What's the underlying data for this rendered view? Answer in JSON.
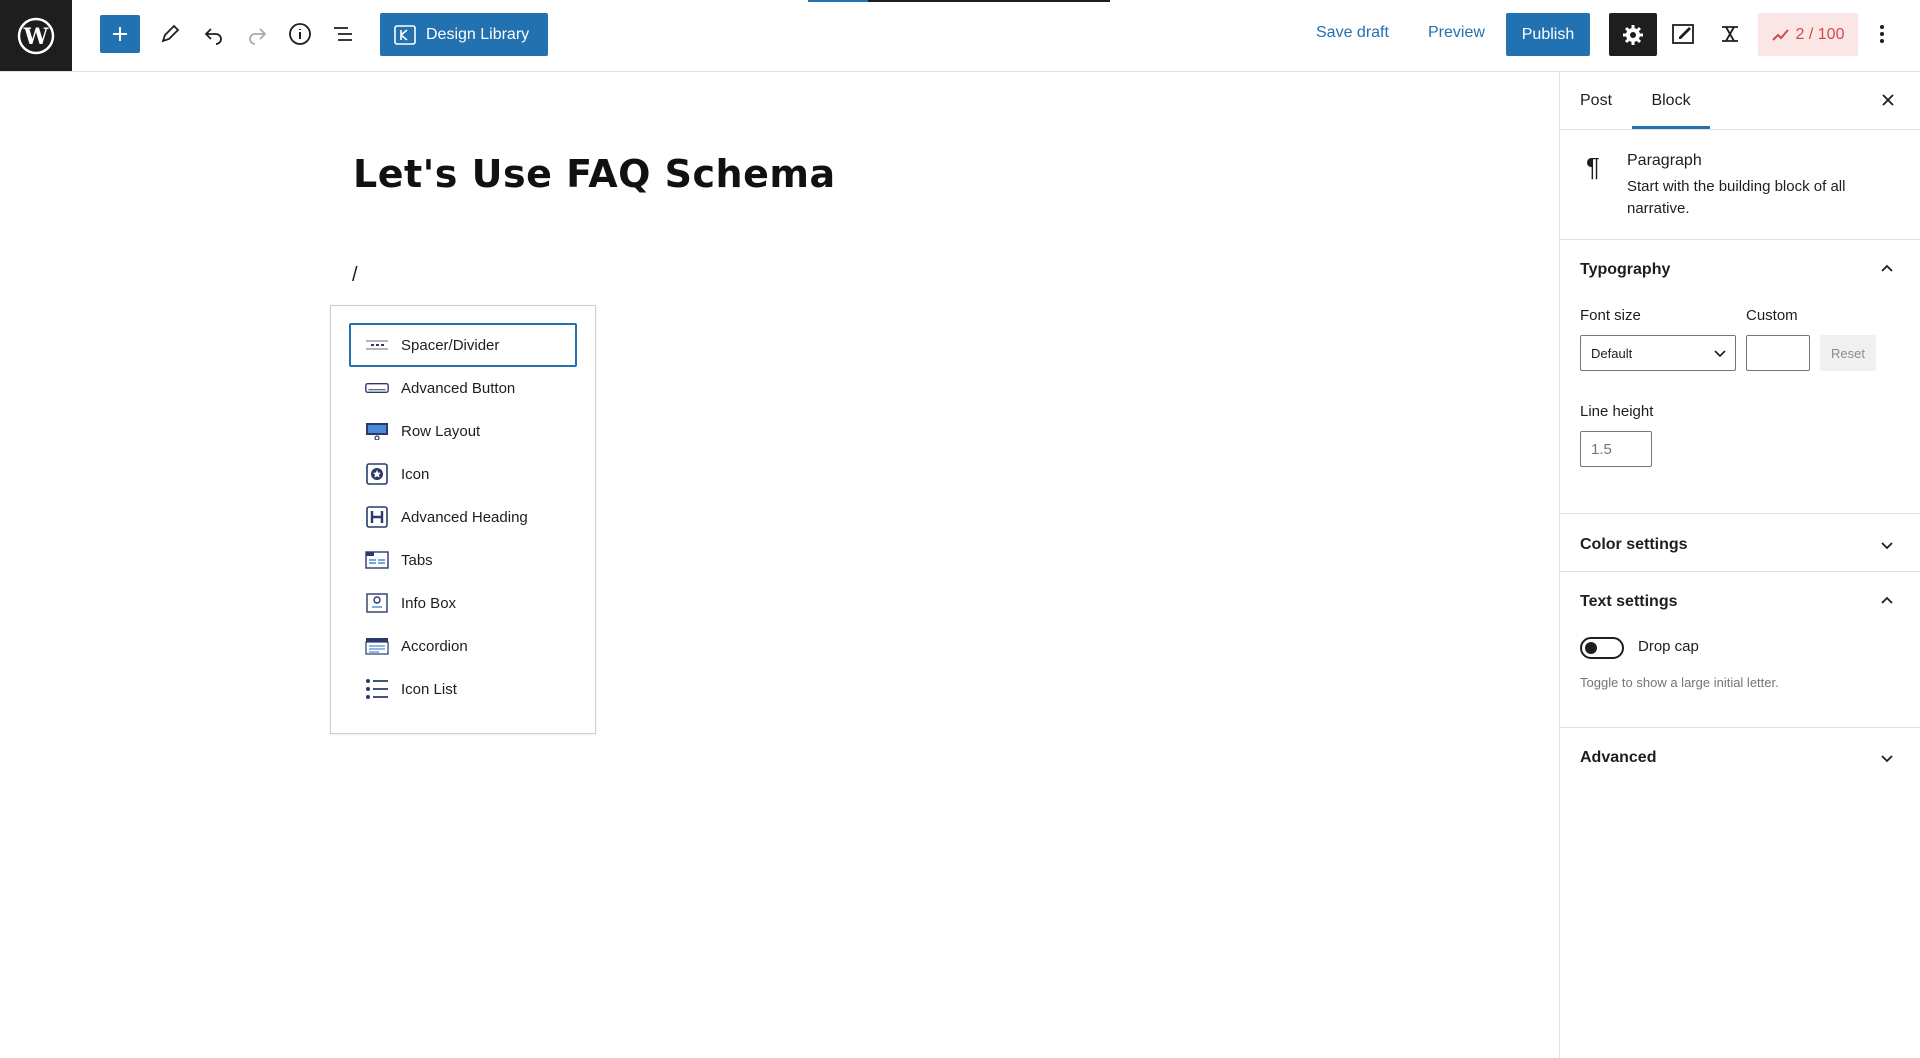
{
  "toolbar": {
    "design_library_label": "Design Library",
    "save_draft_label": "Save draft",
    "preview_label": "Preview",
    "publish_label": "Publish",
    "counter_label": "2 / 100"
  },
  "editor": {
    "post_title": "Let's Use FAQ Schema",
    "paragraph_text": "/"
  },
  "inserter": {
    "items": [
      {
        "label": "Spacer/Divider",
        "icon": "spacer-divider-icon"
      },
      {
        "label": "Advanced Button",
        "icon": "advanced-button-icon"
      },
      {
        "label": "Row Layout",
        "icon": "row-layout-icon"
      },
      {
        "label": "Icon",
        "icon": "icon-block-icon"
      },
      {
        "label": "Advanced Heading",
        "icon": "advanced-heading-icon"
      },
      {
        "label": "Tabs",
        "icon": "tabs-icon"
      },
      {
        "label": "Info Box",
        "icon": "info-box-icon"
      },
      {
        "label": "Accordion",
        "icon": "accordion-icon"
      },
      {
        "label": "Icon List",
        "icon": "icon-list-icon"
      }
    ]
  },
  "sidebar": {
    "tab_post": "Post",
    "tab_block": "Block",
    "block_card": {
      "title": "Paragraph",
      "description": "Start with the building block of all narrative."
    },
    "typography": {
      "title": "Typography",
      "font_size_label": "Font size",
      "custom_label": "Custom",
      "font_size_value": "Default",
      "reset_label": "Reset",
      "line_height_label": "Line height",
      "line_height_value": "1.5"
    },
    "color_settings_title": "Color settings",
    "text_settings": {
      "title": "Text settings",
      "drop_cap_label": "Drop cap",
      "drop_cap_help": "Toggle to show a large initial letter."
    },
    "advanced_title": "Advanced"
  },
  "colors": {
    "accent": "#2271b1",
    "dark": "#1e1e1e"
  }
}
